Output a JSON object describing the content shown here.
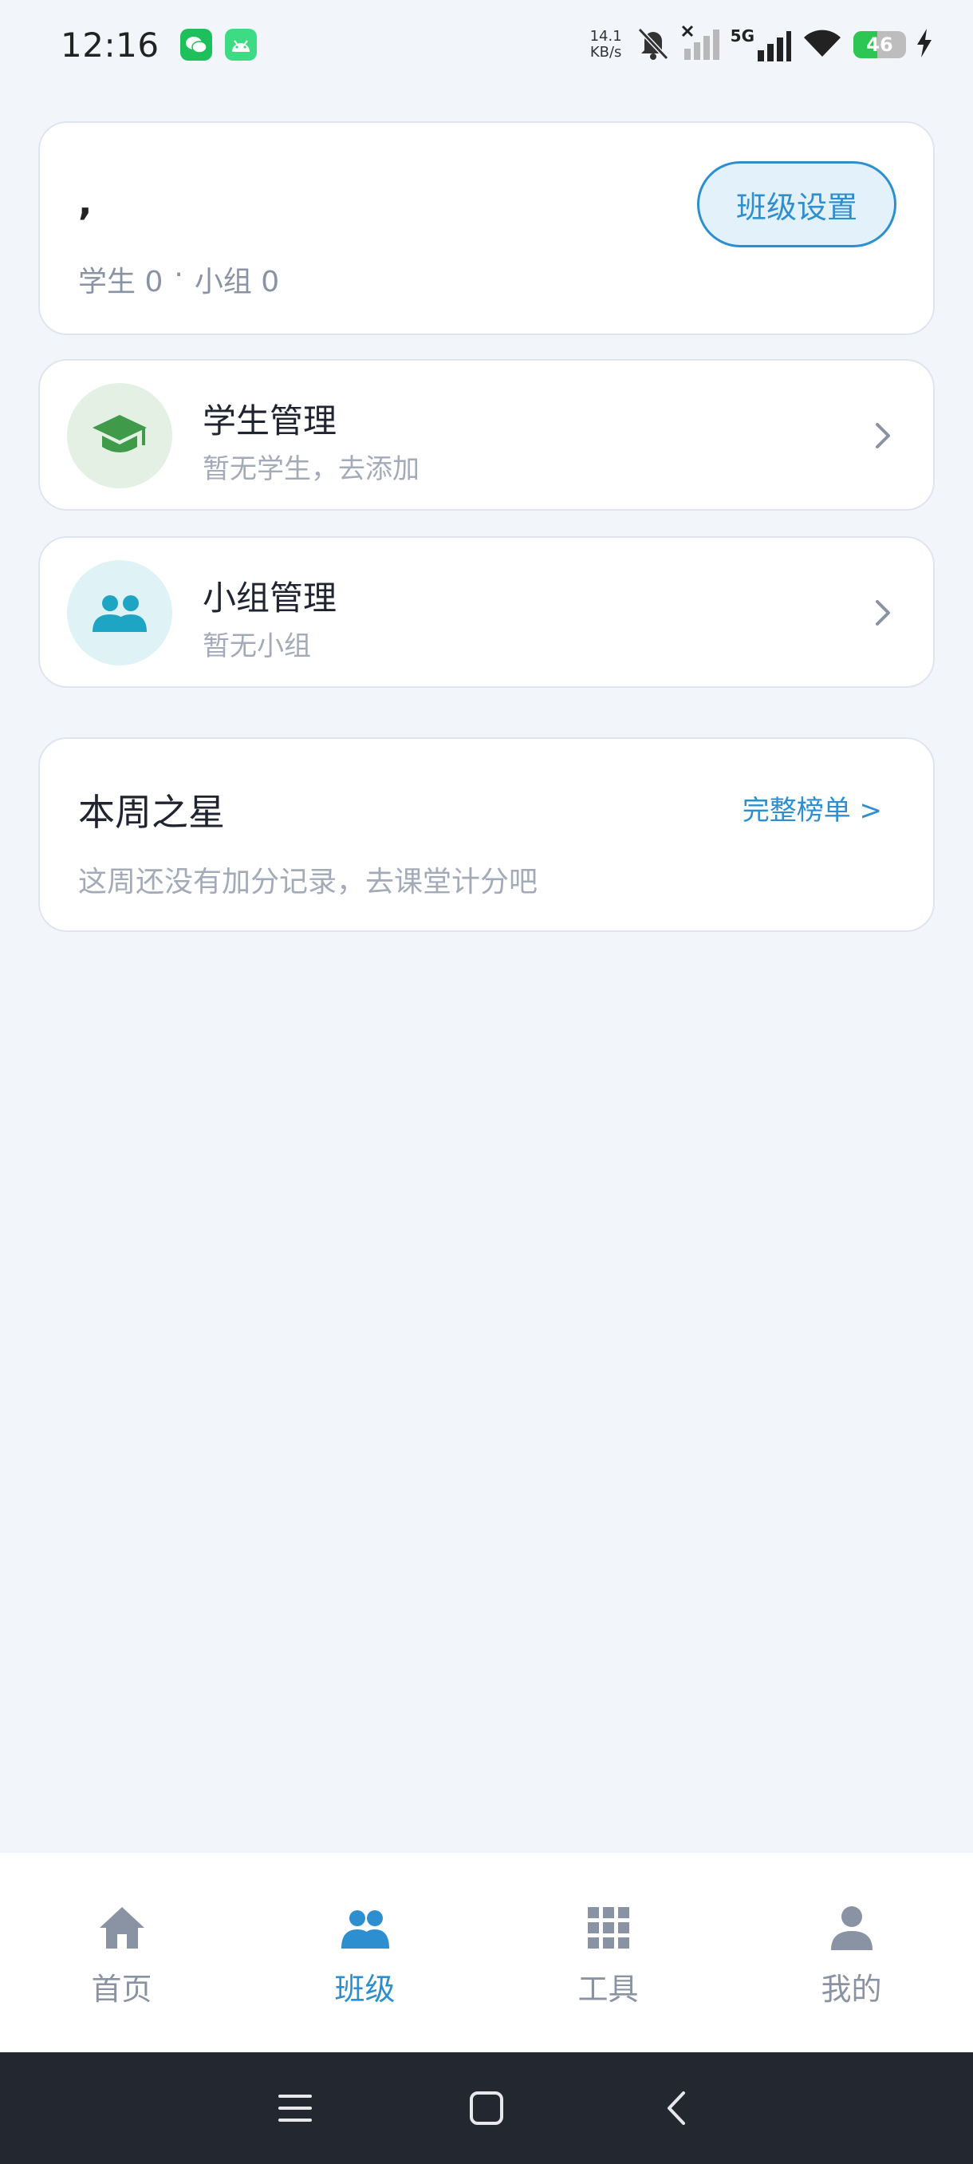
{
  "status_bar": {
    "time": "12:16",
    "net_speed_value": "14.1",
    "net_speed_unit": "KB/s",
    "network_type": "5G",
    "battery_level": "46",
    "battery_fraction": 0.46,
    "icons": [
      "wechat-icon",
      "android-icon",
      "mute-bell-icon",
      "signal-icon",
      "wifi-icon",
      "battery-icon",
      "charging-icon"
    ]
  },
  "class_card": {
    "class_name": ",",
    "students_label": "学生",
    "students_count": "0",
    "separator": "·",
    "groups_label": "小组",
    "groups_count": "0",
    "settings_button": "班级设置"
  },
  "menu": {
    "students": {
      "title": "学生管理",
      "subtitle": "暂无学生，去添加",
      "icon": "graduation-cap-icon",
      "icon_bg": "#e3f0e3",
      "icon_color": "#3f9b4a"
    },
    "groups": {
      "title": "小组管理",
      "subtitle": "暂无小组",
      "icon": "group-icon",
      "icon_bg": "#dff3f7",
      "icon_color": "#1ea5c4"
    }
  },
  "star_card": {
    "title": "本周之星",
    "link": "完整榜单 >",
    "empty_text": "这周还没有加分记录，去课堂计分吧"
  },
  "tabs": [
    {
      "label": "首页",
      "icon": "home-icon",
      "active": false
    },
    {
      "label": "班级",
      "icon": "group-icon",
      "active": true
    },
    {
      "label": "工具",
      "icon": "grid-icon",
      "active": false
    },
    {
      "label": "我的",
      "icon": "person-icon",
      "active": false
    }
  ],
  "colors": {
    "accent": "#2d8fd0",
    "inactive": "#8a93a3",
    "background": "#f2f6fb"
  }
}
